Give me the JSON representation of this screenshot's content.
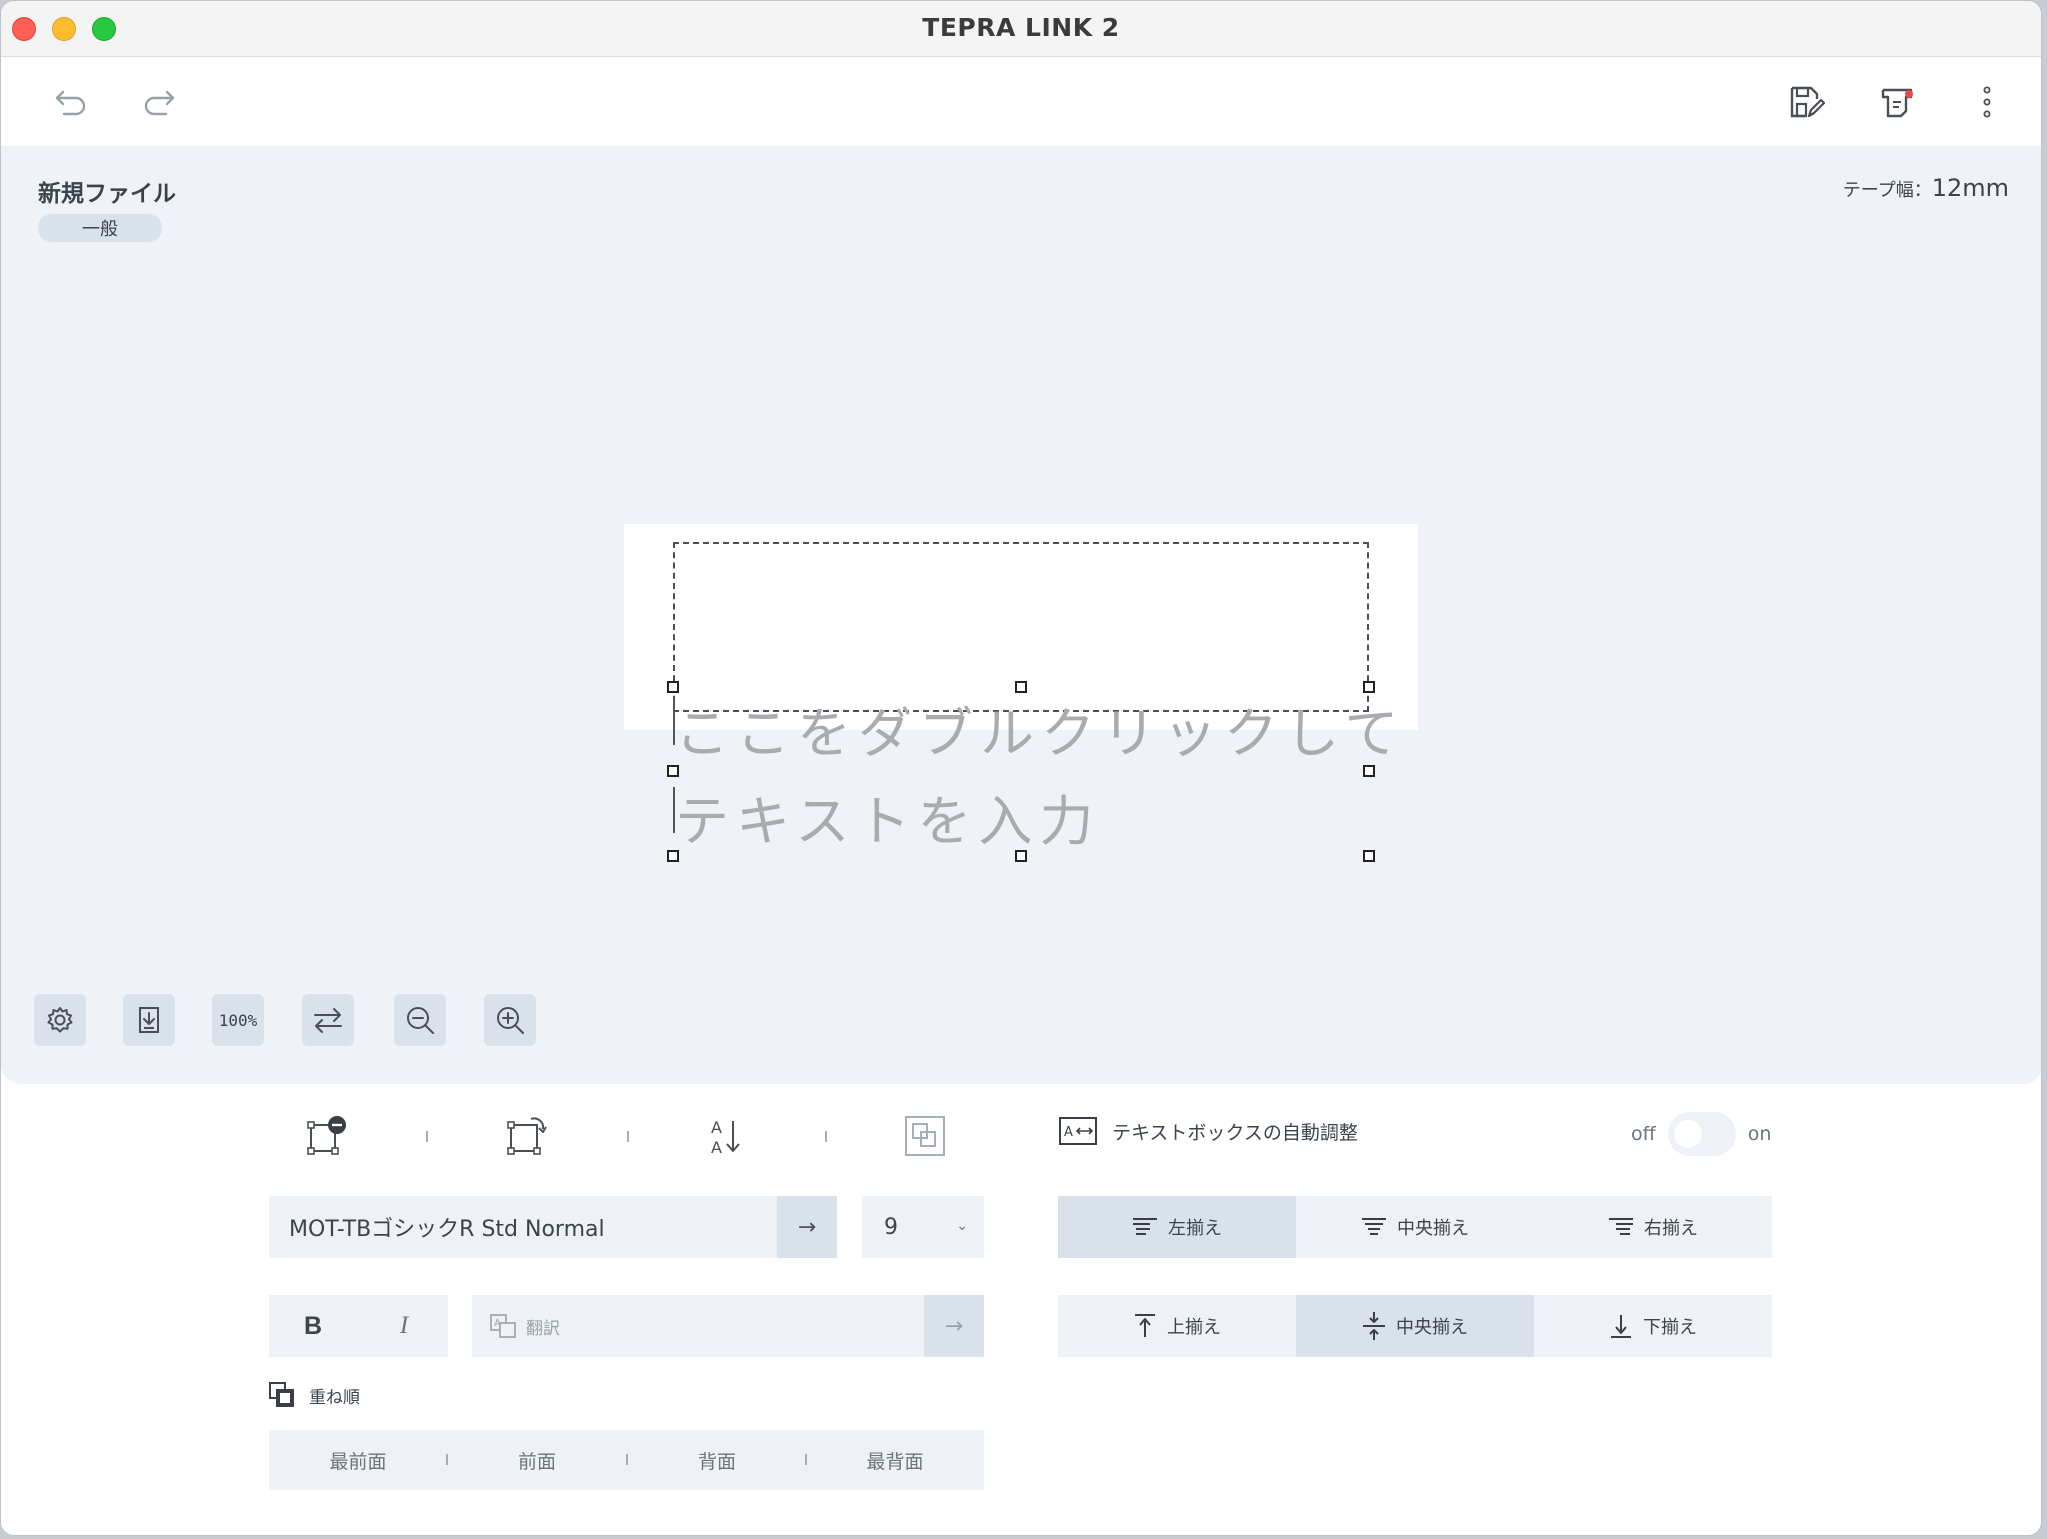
{
  "window": {
    "title": "TEPRA LINK 2"
  },
  "toolbar": {
    "undo_icon": "undo-arrow-icon",
    "redo_icon": "redo-arrow-icon",
    "save_icon": "save-edit-icon",
    "print_icon": "tape-printer-icon",
    "more_icon": "vertical-ellipsis-icon"
  },
  "file": {
    "name": "新規ファイル",
    "category": "一般"
  },
  "tape": {
    "label": "テープ幅：",
    "value": "12mm"
  },
  "canvas": {
    "placeholder_line1": "ここをダブルクリックして",
    "placeholder_line2": "テキストを入力",
    "zoom_label": "100%"
  },
  "text_panel": {
    "font_name": "MOT-TBゴシックR Std Normal",
    "arrow": "→",
    "font_size": "9",
    "size_chevron": "⌄",
    "bold": "B",
    "italic": "I",
    "translate_placeholder": "翻訳",
    "translate_arrow": "→",
    "auto_adjust_label": "テキストボックスの自動調整",
    "toggle_off": "off",
    "toggle_on": "on",
    "h_align": [
      {
        "label": "左揃え",
        "active": true
      },
      {
        "label": "中央揃え",
        "active": false
      },
      {
        "label": "右揃え",
        "active": false
      }
    ],
    "v_align": [
      {
        "label": "上揃え",
        "active": false
      },
      {
        "label": "中央揃え",
        "active": true
      },
      {
        "label": "下揃え",
        "active": false
      }
    ],
    "layer_title": "重ね順",
    "layer_order": [
      "最前面",
      "前面",
      "背面",
      "最背面"
    ]
  },
  "colors": {
    "canvas_bg": "#eff3f7",
    "control_bg": "#eef2f6",
    "active_bg": "#d9e1ea",
    "accent_red": "#e5484d"
  }
}
